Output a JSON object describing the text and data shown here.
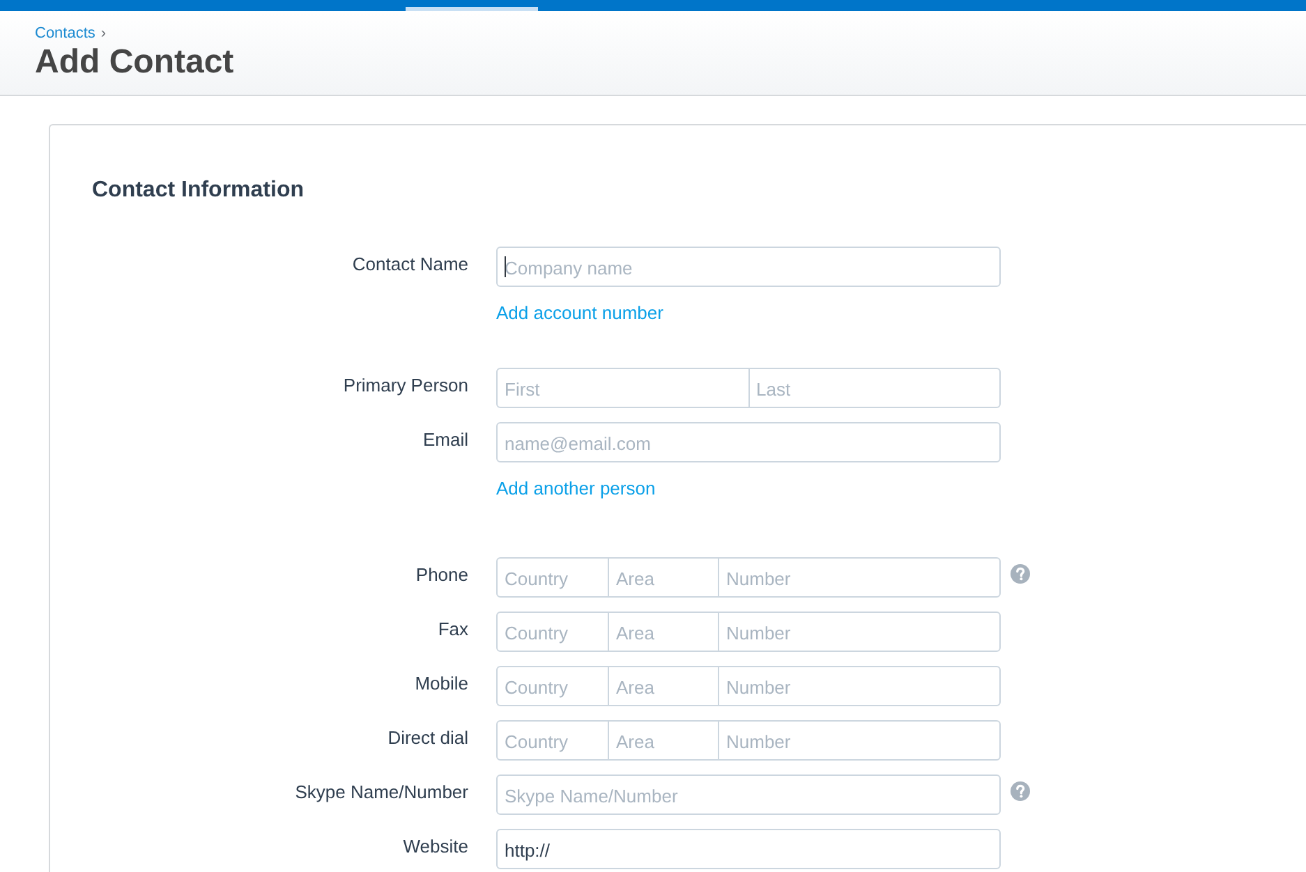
{
  "breadcrumb": {
    "items": [
      {
        "label": "Contacts"
      }
    ],
    "separator": "›"
  },
  "page_title": "Add Contact",
  "section": {
    "title": "Contact Information",
    "groups": [
      {
        "rows": [
          {
            "kind": "single",
            "label": "Contact Name",
            "help": false,
            "fields": [
              {
                "placeholder": "Company name",
                "focused": true
              }
            ]
          }
        ],
        "link": "Add account number"
      },
      {
        "rows": [
          {
            "kind": "name",
            "label": "Primary Person",
            "help": false,
            "fields": [
              {
                "placeholder": "First",
                "focused": false
              },
              {
                "placeholder": "Last",
                "focused": false
              }
            ]
          },
          {
            "kind": "single",
            "label": "Email",
            "help": false,
            "fields": [
              {
                "placeholder": "name@email.com",
                "focused": false
              }
            ]
          }
        ],
        "link": "Add another person"
      },
      {
        "rows": [
          {
            "kind": "phone",
            "label": "Phone",
            "help": true,
            "fields": [
              {
                "placeholder": "Country",
                "focused": false
              },
              {
                "placeholder": "Area",
                "focused": false
              },
              {
                "placeholder": "Number",
                "focused": false
              }
            ]
          },
          {
            "kind": "phone",
            "label": "Fax",
            "help": false,
            "fields": [
              {
                "placeholder": "Country",
                "focused": false
              },
              {
                "placeholder": "Area",
                "focused": false
              },
              {
                "placeholder": "Number",
                "focused": false
              }
            ]
          },
          {
            "kind": "phone",
            "label": "Mobile",
            "help": false,
            "fields": [
              {
                "placeholder": "Country",
                "focused": false
              },
              {
                "placeholder": "Area",
                "focused": false
              },
              {
                "placeholder": "Number",
                "focused": false
              }
            ]
          },
          {
            "kind": "phone",
            "label": "Direct dial",
            "help": false,
            "fields": [
              {
                "placeholder": "Country",
                "focused": false
              },
              {
                "placeholder": "Area",
                "focused": false
              },
              {
                "placeholder": "Number",
                "focused": false
              }
            ]
          },
          {
            "kind": "single",
            "label": "Skype Name/Number",
            "help": true,
            "fields": [
              {
                "placeholder": "Skype Name/Number",
                "focused": false
              }
            ]
          },
          {
            "kind": "single",
            "label": "Website",
            "help": false,
            "fields": [
              {
                "value": "http://",
                "focused": false
              }
            ]
          }
        ]
      }
    ]
  }
}
